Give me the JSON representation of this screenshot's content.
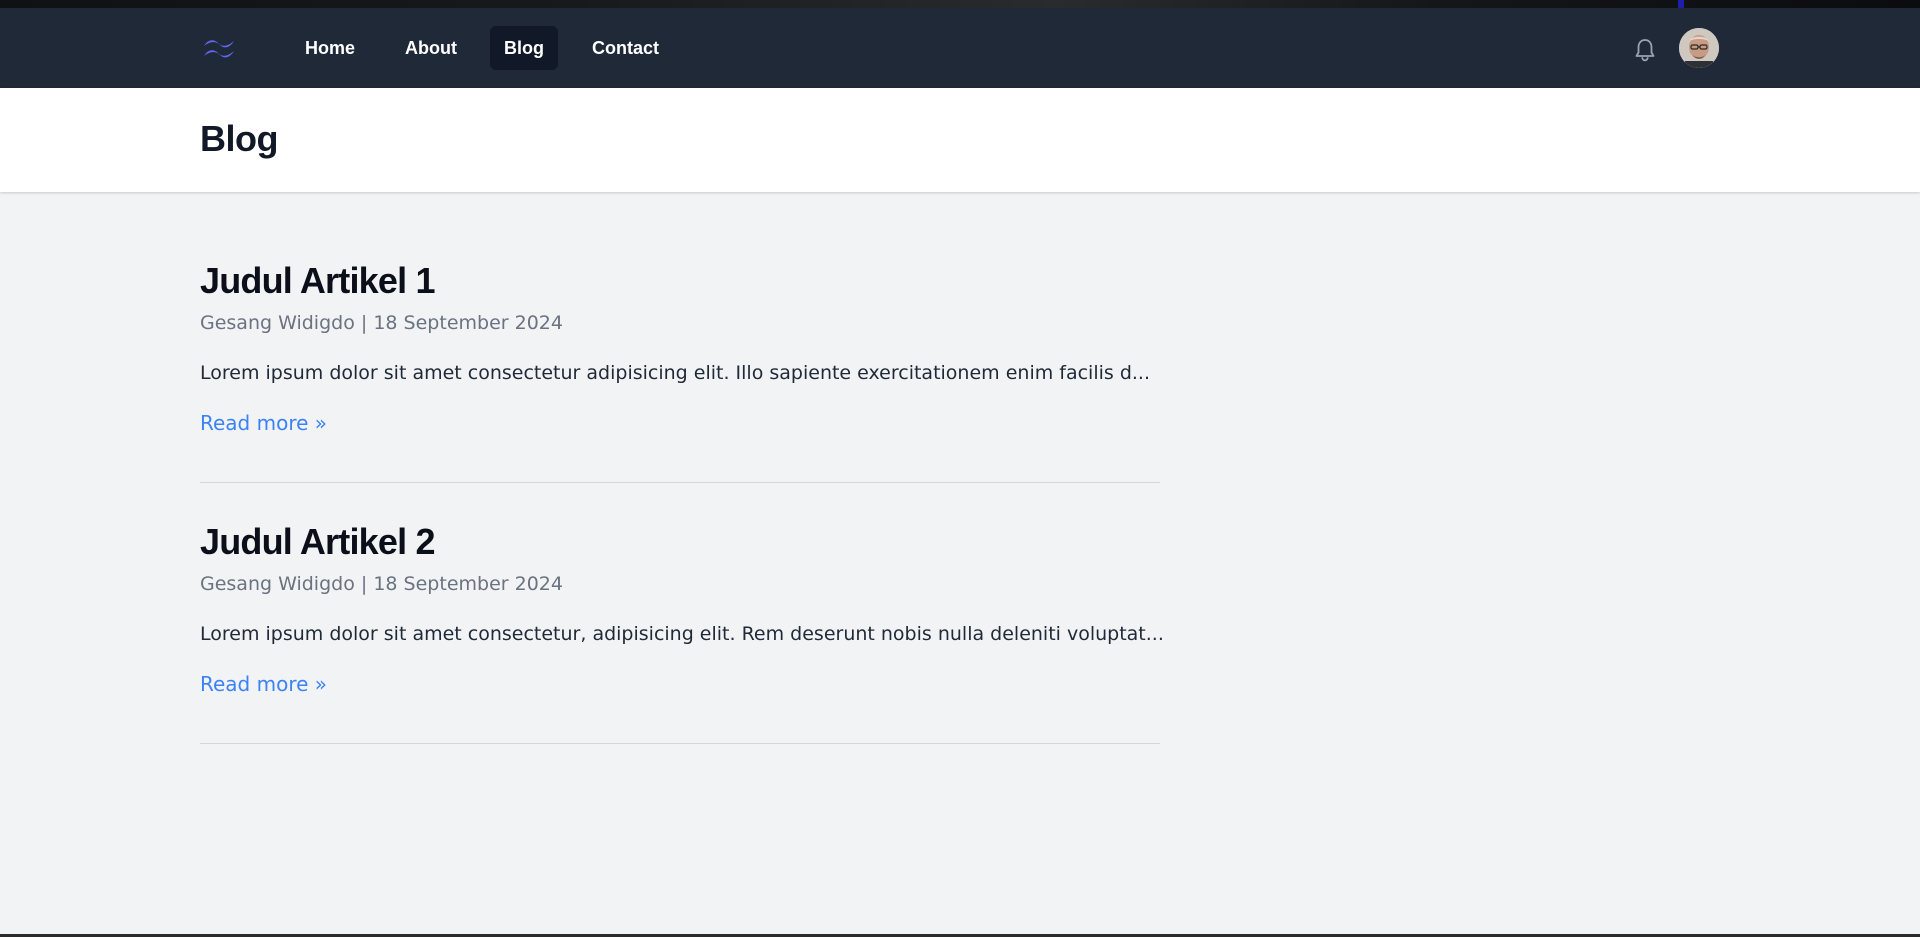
{
  "nav": {
    "logo_icon": "tailwind-logo-icon",
    "links": [
      {
        "label": "Home"
      },
      {
        "label": "About"
      },
      {
        "label": "Blog",
        "active": true
      },
      {
        "label": "Contact"
      }
    ],
    "notification_icon": "bell-icon",
    "avatar_icon": "user-avatar"
  },
  "header": {
    "title": "Blog"
  },
  "articles": [
    {
      "title": "Judul Artikel 1",
      "author": "Gesang Widigdo",
      "separator": "|",
      "date": "18 September 2024",
      "excerpt": "Lorem ipsum dolor sit amet consectetur adipisicing elit. Illo sapiente exercitationem enim facilis d...",
      "read_more": "Read more »"
    },
    {
      "title": "Judul Artikel 2",
      "author": "Gesang Widigdo",
      "separator": "|",
      "date": "18 September 2024",
      "excerpt": "Lorem ipsum dolor sit amet consectetur, adipisicing elit. Rem deserunt nobis nulla deleniti voluptat...",
      "read_more": "Read more »"
    }
  ],
  "colors": {
    "nav_bg": "#1f2937",
    "nav_active_bg": "#111827",
    "page_bg": "#f2f3f5",
    "link": "#3b82f6",
    "logo": "#6366f1"
  }
}
